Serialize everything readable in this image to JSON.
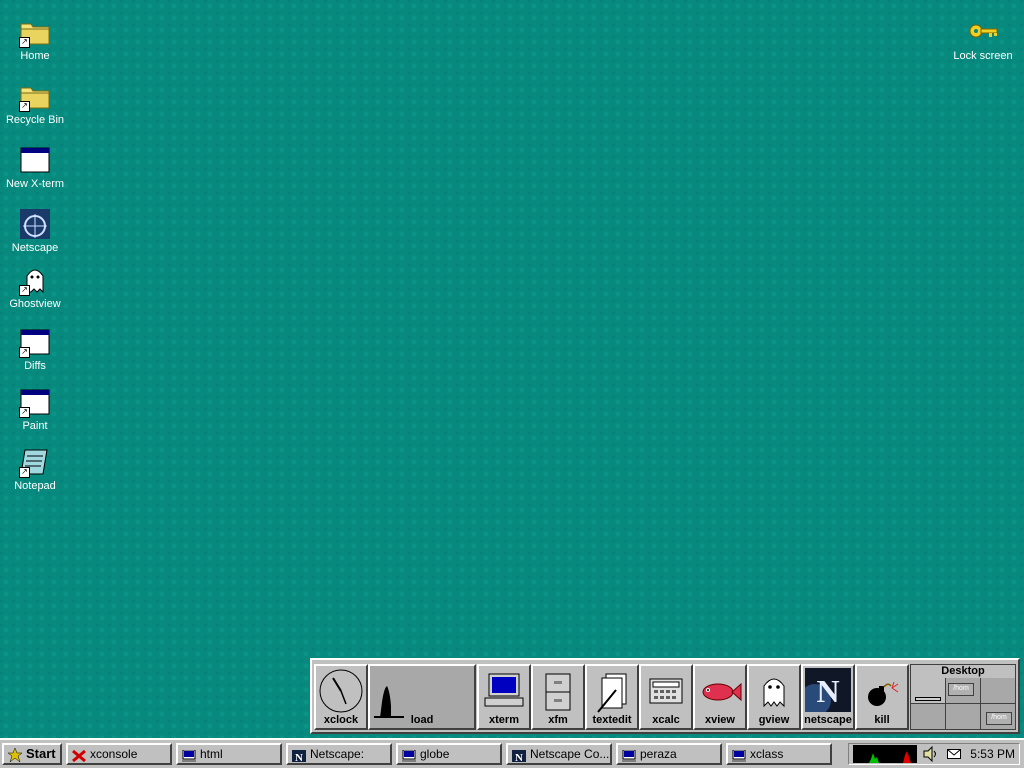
{
  "desktop": {
    "icons": [
      {
        "label": "Home",
        "icon": "folder-icon"
      },
      {
        "label": "Recycle Bin",
        "icon": "folder-icon"
      },
      {
        "label": "New X-term",
        "icon": "window-icon"
      },
      {
        "label": "Netscape",
        "icon": "netscape-wheel-icon"
      },
      {
        "label": "Ghostview",
        "icon": "ghost-icon"
      },
      {
        "label": "Diffs",
        "icon": "window-icon"
      },
      {
        "label": "Paint",
        "icon": "window-icon"
      },
      {
        "label": "Notepad",
        "icon": "notepad-icon"
      }
    ],
    "lock": {
      "label": "Lock screen",
      "icon": "key-icon"
    },
    "colors": {
      "background": "#078a7d",
      "text": "#ffffff"
    }
  },
  "dock": {
    "items": [
      {
        "label": "xclock",
        "icon": "clock-icon"
      },
      {
        "label": "load",
        "icon": "load-graph-icon"
      },
      {
        "label": "xterm",
        "icon": "computer-icon"
      },
      {
        "label": "xfm",
        "icon": "file-cabinet-icon"
      },
      {
        "label": "textedit",
        "icon": "pages-icon"
      },
      {
        "label": "xcalc",
        "icon": "calculator-icon"
      },
      {
        "label": "xview",
        "icon": "fish-icon"
      },
      {
        "label": "gview",
        "icon": "ghost-icon"
      },
      {
        "label": "netscape",
        "icon": "netscape-n-icon"
      },
      {
        "label": "kill",
        "icon": "bomb-icon"
      }
    ],
    "pager": {
      "title": "Desktop",
      "windows": [
        "/hom",
        "/hom"
      ]
    }
  },
  "taskbar": {
    "start_label": "Start",
    "tasks": [
      {
        "label": "xconsole",
        "icon": "x-icon"
      },
      {
        "label": "html",
        "icon": "terminal-icon"
      },
      {
        "label": "Netscape:",
        "icon": "netscape-n-icon"
      },
      {
        "label": "globe",
        "icon": "terminal-icon"
      },
      {
        "label": "Netscape Co...",
        "icon": "netscape-n-icon"
      },
      {
        "label": "peraza",
        "icon": "terminal-icon"
      },
      {
        "label": "xclass",
        "icon": "terminal-icon"
      }
    ],
    "tray": {
      "time": "5:53 PM",
      "icons": [
        "cpu-graph-icon",
        "speaker-icon",
        "mail-icon"
      ]
    }
  }
}
